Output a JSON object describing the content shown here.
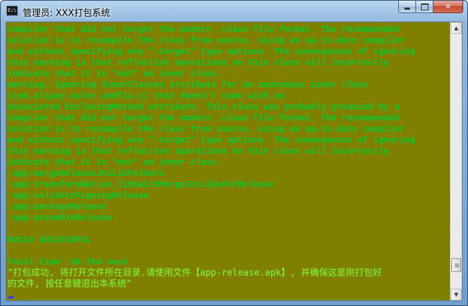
{
  "window": {
    "title": "管理员: XXX打包系统",
    "icon": "cmd-console-icon",
    "icon_text": "C:\\"
  },
  "caption": {
    "minimize": "minimize",
    "maximize": "maximize",
    "close_glyph": "✕"
  },
  "console": {
    "lines": [
      "compiler that did not target the modern .class file format. The recommended",
      "solution is to recompile the class from source, using an up-to-date compiler",
      "and without specifying any \"-target\" type options. The consequence of ignoring",
      "this warning is that reflective operations on this class will incorrectly",
      "indicate that it is *not* an inner class.",
      "warning: Ignoring InnerClasses attribute for an anonymous inner class",
      "(com.alipay.euler.andfix.c) that doesn't come with an",
      "associated EnclosingMethod attribute. This class was probably produced by a",
      "compiler that did not target the modern .class file format. The recommended",
      "solution is to recompile the class from source, using an up-to-date compiler",
      "and without specifying any \"-target\" type options. The consequence of ignoring",
      "this warning is that reflective operations on this class will incorrectly",
      "indicate that it is *not* an inner class.",
      ":app:mergeReleaseJniLibFolders",
      ":app:transformNative_libsWithMergeJniLibsForRelease",
      ":app:validateSigningRelease",
      ":app:packageRelease",
      ":app:assembleRelease",
      "",
      "BUILD SUCCESSFUL",
      "",
      "Total time: 39.794 secs",
      "\"打包成功, 将打开文件所在目录.请使用文件【app-release.apk】, 并确保这是刚打包好",
      "的文件, 按任意键退出本系统\""
    ],
    "colors": {
      "background": "#808000",
      "text": "#00cc33",
      "highlight_text": "#7dff3a",
      "cursor": "#3b3bff"
    }
  },
  "scrollbar": {
    "up_arrow": "▲",
    "down_arrow": "▼",
    "position": 0.93
  }
}
